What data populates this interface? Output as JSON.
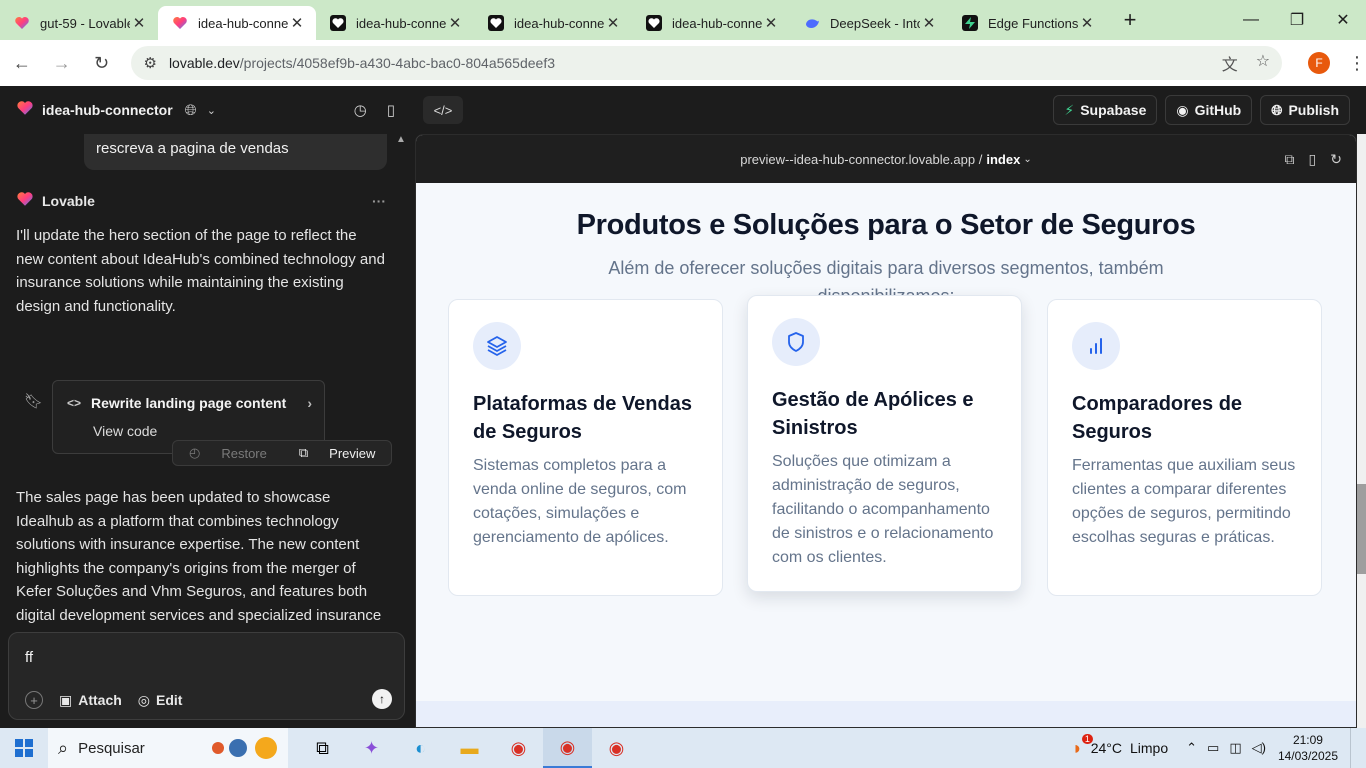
{
  "browser": {
    "tabs": [
      {
        "title": "gut-59 - Lovable",
        "active": false,
        "icon": "lovable-heart-icon"
      },
      {
        "title": "idea-hub-conne",
        "active": true,
        "icon": "lovable-heart-icon"
      },
      {
        "title": "idea-hub-conne",
        "active": false,
        "icon": "heart-icon"
      },
      {
        "title": "idea-hub-conne",
        "active": false,
        "icon": "heart-icon"
      },
      {
        "title": "idea-hub-conne",
        "active": false,
        "icon": "heart-icon"
      },
      {
        "title": "DeepSeek - Into",
        "active": false,
        "icon": "deepseek-whale-icon"
      },
      {
        "title": "Edge Functions |",
        "active": false,
        "icon": "supabase-icon"
      }
    ],
    "url_host": "lovable.dev",
    "url_path": "/projects/4058ef9b-a430-4abc-bac0-804a565deef3",
    "profile_initial": "F"
  },
  "app": {
    "project_name": "idea-hub-connector",
    "header_buttons": {
      "supabase": "Supabase",
      "github": "GitHub",
      "publish": "Publish"
    }
  },
  "chat": {
    "user_message": "rescreva a pagina de vendas",
    "bot_name": "Lovable",
    "intro": "I'll update the hero section of the page to reflect the new content about IdeaHub's combined technology and insurance solutions while maintaining the existing design and functionality.",
    "edit_card": {
      "title": "Rewrite landing page content",
      "view_code": "View code",
      "restore": "Restore",
      "preview": "Preview"
    },
    "summary": "The sales page has been updated to showcase Idealhub as a platform that combines technology solutions with insurance expertise. The new content highlights the company's origins from the merger of Kefer Soluções and Vhm Seguros, and features both digital development services and specialized insurance solutions.",
    "input_value": "ff",
    "attach_label": "Attach",
    "edit_label": "Edit"
  },
  "preview": {
    "url": "preview--idea-hub-connector.lovable.app",
    "separator": "/",
    "route": "index",
    "heading": "Produtos e Soluções para o Setor de Seguros",
    "subheading": "Além de oferecer soluções digitais para diversos segmentos, também disponibilizamos:",
    "cards": [
      {
        "icon": "layers-icon",
        "title": "Plataformas de Vendas de Seguros",
        "text": "Sistemas completos para a venda online de seguros, com cotações, simulações e gerenciamento de apólices."
      },
      {
        "icon": "shield-icon",
        "title": "Gestão de Apólices e Sinistros",
        "text": "Soluções que otimizam a administração de seguros, facilitando o acompanhamento de sinistros e o relacionamento com os clientes."
      },
      {
        "icon": "bar-chart-icon",
        "title": "Comparadores de Seguros",
        "text": "Ferramentas que auxiliam seus clientes a comparar diferentes opções de seguros, permitindo escolhas seguras e práticas."
      }
    ],
    "accent_color": "#2563eb"
  },
  "taskbar": {
    "search_placeholder": "Pesquisar",
    "weather_temp": "24°C",
    "weather_desc": "Limpo",
    "weather_alert": "1",
    "time": "21:09",
    "date": "14/03/2025"
  }
}
